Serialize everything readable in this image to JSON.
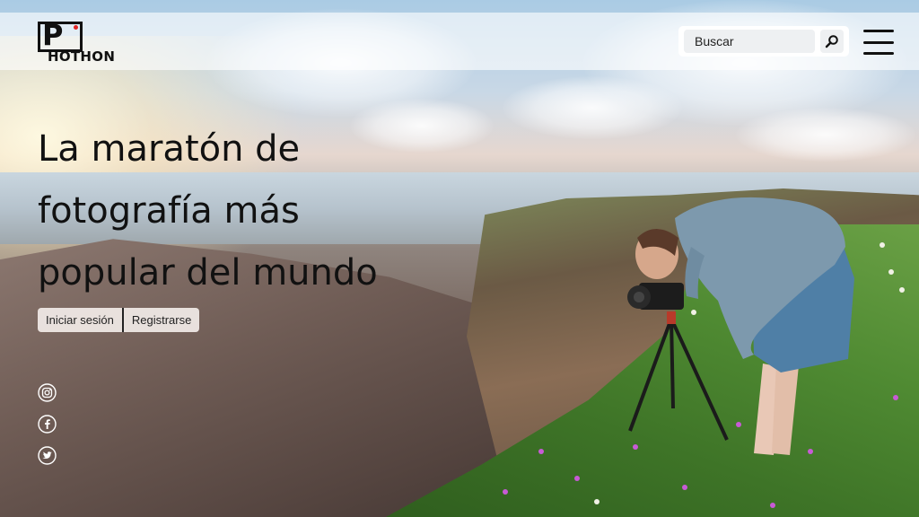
{
  "brand": {
    "logo_text": "HOTHON",
    "logo_letter": "P"
  },
  "search": {
    "placeholder": "Buscar",
    "value": ""
  },
  "headline": {
    "lines": [
      "La maratón de",
      "fotografía más",
      "popular del mundo"
    ]
  },
  "auth": {
    "login_label": "Iniciar sesión",
    "register_label": "Registrarse"
  },
  "social": {
    "icons": [
      "instagram-icon",
      "facebook-icon",
      "twitter-icon"
    ]
  },
  "colors": {
    "text": "#111111",
    "accent_dot": "#e02424",
    "topbar_bg": "rgba(255,255,255,0.62)"
  }
}
